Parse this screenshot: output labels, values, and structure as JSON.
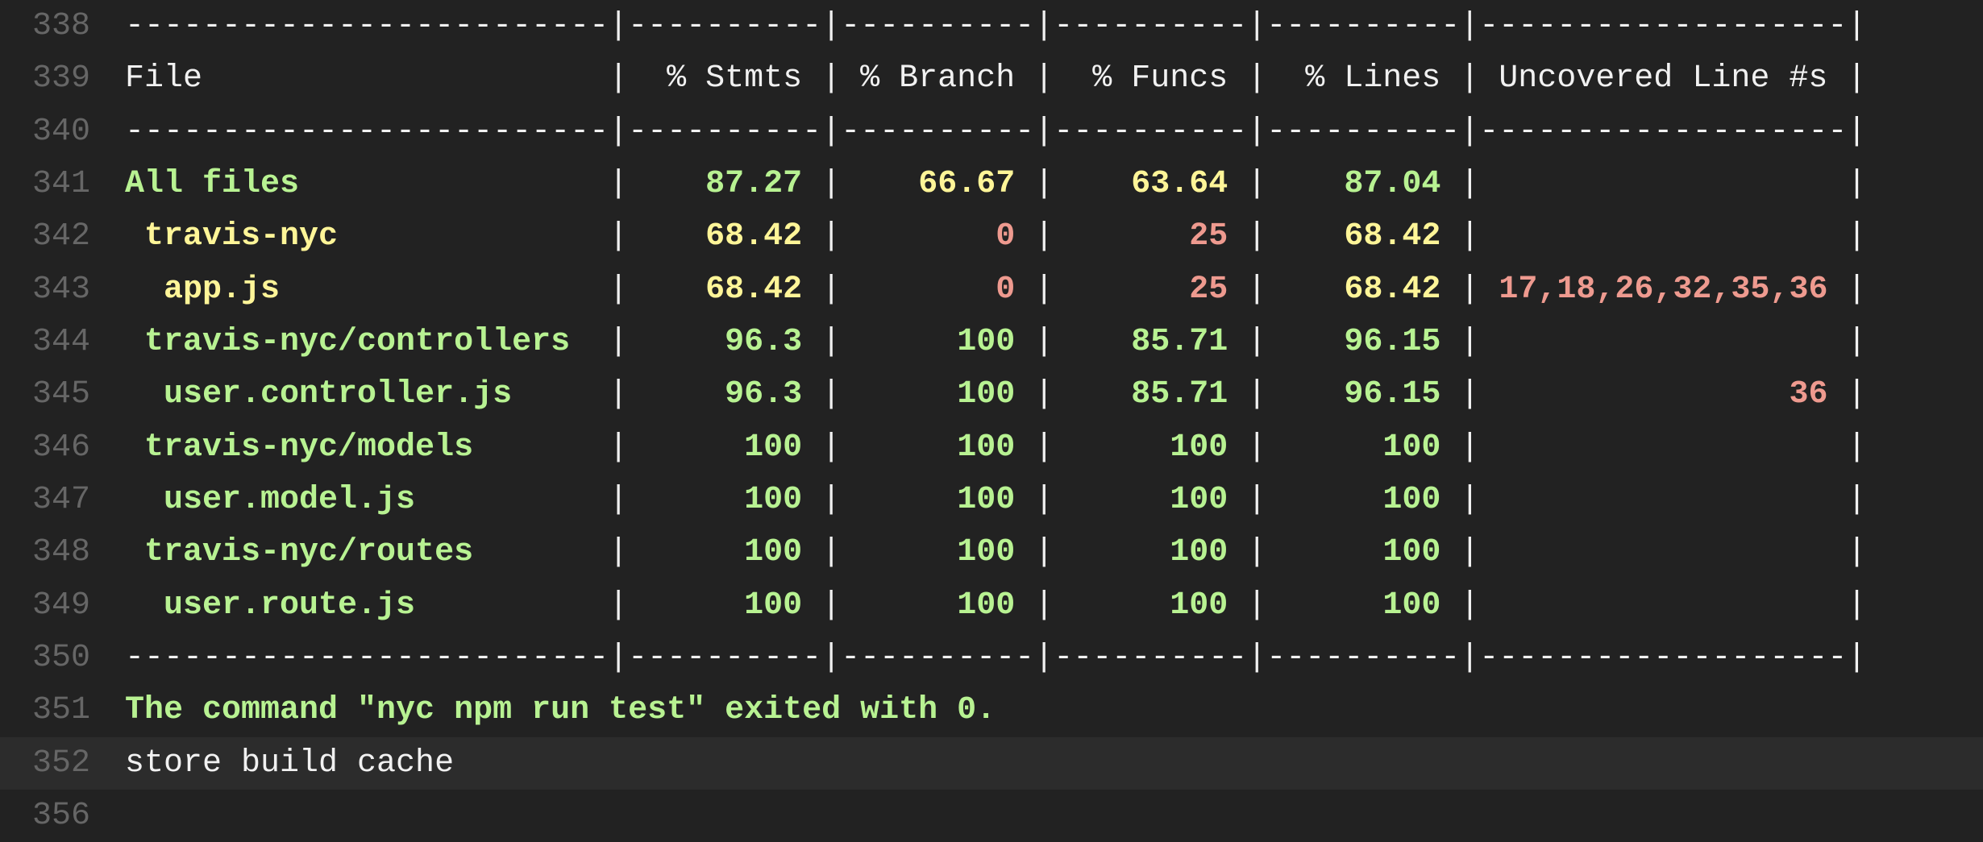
{
  "lines": [
    {
      "n": "338",
      "segments": [
        {
          "t": "-------------------------|----------|----------|----------|----------|-------------------|",
          "c": "w"
        }
      ]
    },
    {
      "n": "339",
      "segments": [
        {
          "t": "File                     |  % Stmts | % Branch |  % Funcs |  % Lines | Uncovered Line #s |",
          "c": "w"
        }
      ]
    },
    {
      "n": "340",
      "segments": [
        {
          "t": "-------------------------|----------|----------|----------|----------|-------------------|",
          "c": "w"
        }
      ]
    },
    {
      "n": "341",
      "segments": [
        {
          "t": "All files                ",
          "c": "g"
        },
        {
          "t": "|",
          "c": "w"
        },
        {
          "t": "    87.27 ",
          "c": "g"
        },
        {
          "t": "|",
          "c": "w"
        },
        {
          "t": "    66.67 ",
          "c": "y"
        },
        {
          "t": "|",
          "c": "w"
        },
        {
          "t": "    63.64 ",
          "c": "y"
        },
        {
          "t": "|",
          "c": "w"
        },
        {
          "t": "    87.04 ",
          "c": "g"
        },
        {
          "t": "|",
          "c": "w"
        },
        {
          "t": "                   ",
          "c": "w"
        },
        {
          "t": "|",
          "c": "w"
        }
      ]
    },
    {
      "n": "342",
      "segments": [
        {
          "t": " travis-nyc              ",
          "c": "y"
        },
        {
          "t": "|",
          "c": "w"
        },
        {
          "t": "    68.42 ",
          "c": "y"
        },
        {
          "t": "|",
          "c": "w"
        },
        {
          "t": "        0 ",
          "c": "r"
        },
        {
          "t": "|",
          "c": "w"
        },
        {
          "t": "       25 ",
          "c": "r"
        },
        {
          "t": "|",
          "c": "w"
        },
        {
          "t": "    68.42 ",
          "c": "y"
        },
        {
          "t": "|",
          "c": "w"
        },
        {
          "t": "                   ",
          "c": "w"
        },
        {
          "t": "|",
          "c": "w"
        }
      ]
    },
    {
      "n": "343",
      "segments": [
        {
          "t": "  app.js                 ",
          "c": "y"
        },
        {
          "t": "|",
          "c": "w"
        },
        {
          "t": "    68.42 ",
          "c": "y"
        },
        {
          "t": "|",
          "c": "w"
        },
        {
          "t": "        0 ",
          "c": "r"
        },
        {
          "t": "|",
          "c": "w"
        },
        {
          "t": "       25 ",
          "c": "r"
        },
        {
          "t": "|",
          "c": "w"
        },
        {
          "t": "    68.42 ",
          "c": "y"
        },
        {
          "t": "|",
          "c": "w"
        },
        {
          "t": " 17,18,26,32,35,36 ",
          "c": "r"
        },
        {
          "t": "|",
          "c": "w"
        }
      ]
    },
    {
      "n": "344",
      "segments": [
        {
          "t": " travis-nyc/controllers  ",
          "c": "g"
        },
        {
          "t": "|",
          "c": "w"
        },
        {
          "t": "     96.3 ",
          "c": "g"
        },
        {
          "t": "|",
          "c": "w"
        },
        {
          "t": "      100 ",
          "c": "g"
        },
        {
          "t": "|",
          "c": "w"
        },
        {
          "t": "    85.71 ",
          "c": "g"
        },
        {
          "t": "|",
          "c": "w"
        },
        {
          "t": "    96.15 ",
          "c": "g"
        },
        {
          "t": "|",
          "c": "w"
        },
        {
          "t": "                   ",
          "c": "w"
        },
        {
          "t": "|",
          "c": "w"
        }
      ]
    },
    {
      "n": "345",
      "segments": [
        {
          "t": "  user.controller.js     ",
          "c": "g"
        },
        {
          "t": "|",
          "c": "w"
        },
        {
          "t": "     96.3 ",
          "c": "g"
        },
        {
          "t": "|",
          "c": "w"
        },
        {
          "t": "      100 ",
          "c": "g"
        },
        {
          "t": "|",
          "c": "w"
        },
        {
          "t": "    85.71 ",
          "c": "g"
        },
        {
          "t": "|",
          "c": "w"
        },
        {
          "t": "    96.15 ",
          "c": "g"
        },
        {
          "t": "|",
          "c": "w"
        },
        {
          "t": "                36 ",
          "c": "r"
        },
        {
          "t": "|",
          "c": "w"
        }
      ]
    },
    {
      "n": "346",
      "segments": [
        {
          "t": " travis-nyc/models       ",
          "c": "g"
        },
        {
          "t": "|",
          "c": "w"
        },
        {
          "t": "      100 ",
          "c": "g"
        },
        {
          "t": "|",
          "c": "w"
        },
        {
          "t": "      100 ",
          "c": "g"
        },
        {
          "t": "|",
          "c": "w"
        },
        {
          "t": "      100 ",
          "c": "g"
        },
        {
          "t": "|",
          "c": "w"
        },
        {
          "t": "      100 ",
          "c": "g"
        },
        {
          "t": "|",
          "c": "w"
        },
        {
          "t": "                   ",
          "c": "w"
        },
        {
          "t": "|",
          "c": "w"
        }
      ]
    },
    {
      "n": "347",
      "segments": [
        {
          "t": "  user.model.js          ",
          "c": "g"
        },
        {
          "t": "|",
          "c": "w"
        },
        {
          "t": "      100 ",
          "c": "g"
        },
        {
          "t": "|",
          "c": "w"
        },
        {
          "t": "      100 ",
          "c": "g"
        },
        {
          "t": "|",
          "c": "w"
        },
        {
          "t": "      100 ",
          "c": "g"
        },
        {
          "t": "|",
          "c": "w"
        },
        {
          "t": "      100 ",
          "c": "g"
        },
        {
          "t": "|",
          "c": "w"
        },
        {
          "t": "                   ",
          "c": "w"
        },
        {
          "t": "|",
          "c": "w"
        }
      ]
    },
    {
      "n": "348",
      "segments": [
        {
          "t": " travis-nyc/routes       ",
          "c": "g"
        },
        {
          "t": "|",
          "c": "w"
        },
        {
          "t": "      100 ",
          "c": "g"
        },
        {
          "t": "|",
          "c": "w"
        },
        {
          "t": "      100 ",
          "c": "g"
        },
        {
          "t": "|",
          "c": "w"
        },
        {
          "t": "      100 ",
          "c": "g"
        },
        {
          "t": "|",
          "c": "w"
        },
        {
          "t": "      100 ",
          "c": "g"
        },
        {
          "t": "|",
          "c": "w"
        },
        {
          "t": "                   ",
          "c": "w"
        },
        {
          "t": "|",
          "c": "w"
        }
      ]
    },
    {
      "n": "349",
      "segments": [
        {
          "t": "  user.route.js          ",
          "c": "g"
        },
        {
          "t": "|",
          "c": "w"
        },
        {
          "t": "      100 ",
          "c": "g"
        },
        {
          "t": "|",
          "c": "w"
        },
        {
          "t": "      100 ",
          "c": "g"
        },
        {
          "t": "|",
          "c": "w"
        },
        {
          "t": "      100 ",
          "c": "g"
        },
        {
          "t": "|",
          "c": "w"
        },
        {
          "t": "      100 ",
          "c": "g"
        },
        {
          "t": "|",
          "c": "w"
        },
        {
          "t": "                   ",
          "c": "w"
        },
        {
          "t": "|",
          "c": "w"
        }
      ]
    },
    {
      "n": "350",
      "segments": [
        {
          "t": "-------------------------|----------|----------|----------|----------|-------------------|",
          "c": "w"
        }
      ]
    },
    {
      "n": "351",
      "segments": [
        {
          "t": "The command \"nyc npm run test\" exited with 0.",
          "c": "gb"
        }
      ]
    },
    {
      "n": "352",
      "highlight": true,
      "segments": [
        {
          "t": "store build cache",
          "c": "w"
        }
      ]
    },
    {
      "n": "356",
      "segments": []
    }
  ]
}
